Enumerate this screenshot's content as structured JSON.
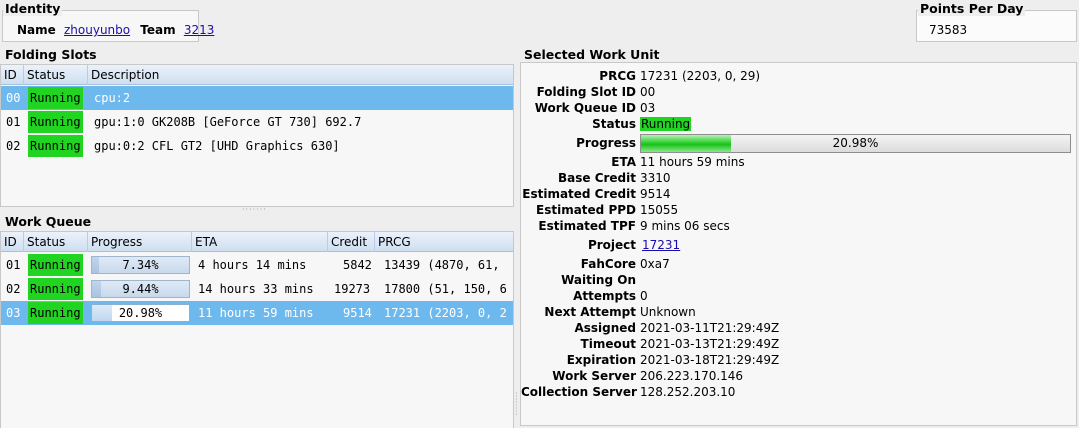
{
  "identity": {
    "title": "Identity",
    "name_label": "Name",
    "name_value": "zhouyunbo",
    "team_label": "Team",
    "team_value": "3213"
  },
  "ppd": {
    "title": "Points Per Day",
    "value": "73583"
  },
  "slots": {
    "title": "Folding Slots",
    "headers": [
      "ID",
      "Status",
      "Description"
    ],
    "rows": [
      {
        "id": "00",
        "status": "Running",
        "description": "cpu:2",
        "selected": true
      },
      {
        "id": "01",
        "status": "Running",
        "description": "gpu:1:0 GK208B [GeForce GT 730] 692.7",
        "selected": false
      },
      {
        "id": "02",
        "status": "Running",
        "description": "gpu:0:2 CFL GT2 [UHD Graphics 630]",
        "selected": false
      }
    ]
  },
  "queue": {
    "title": "Work Queue",
    "headers": [
      "ID",
      "Status",
      "Progress",
      "ETA",
      "Credit",
      "PRCG"
    ],
    "rows": [
      {
        "id": "01",
        "status": "Running",
        "progress_text": "7.34%",
        "progress": 0.0734,
        "eta": "4 hours 14 mins",
        "credit": "5842",
        "prcg": "13439 (4870, 61,",
        "selected": false
      },
      {
        "id": "02",
        "status": "Running",
        "progress_text": "9.44%",
        "progress": 0.0944,
        "eta": "14 hours 33 mins",
        "credit": "19273",
        "prcg": "17800 (51, 150, 6",
        "selected": false
      },
      {
        "id": "03",
        "status": "Running",
        "progress_text": "20.98%",
        "progress": 0.2098,
        "eta": "11 hours 59 mins",
        "credit": "9514",
        "prcg": "17231 (2203, 0, 2",
        "selected": true
      }
    ]
  },
  "unit": {
    "title": "Selected Work Unit",
    "prcg_label": "PRCG",
    "prcg": "17231 (2203, 0, 29)",
    "slot_label": "Folding Slot ID",
    "slot": "00",
    "wq_label": "Work Queue ID",
    "wq": "03",
    "status_label": "Status",
    "status": "Running",
    "progress_label": "Progress",
    "progress_text": "20.98%",
    "progress": 0.2098,
    "eta_label": "ETA",
    "eta": "11 hours 59 mins",
    "base_credit_label": "Base Credit",
    "base_credit": "3310",
    "est_credit_label": "Estimated Credit",
    "est_credit": "9514",
    "est_ppd_label": "Estimated PPD",
    "est_ppd": "15055",
    "est_tpf_label": "Estimated TPF",
    "est_tpf": "9 mins 06 secs",
    "project_label": "Project",
    "project": "17231",
    "fahcore_label": "FahCore",
    "fahcore": "0xa7",
    "waiting_label": "Waiting On",
    "waiting": "",
    "attempts_label": "Attempts",
    "attempts": "0",
    "next_attempt_label": "Next Attempt",
    "next_attempt": "Unknown",
    "assigned_label": "Assigned",
    "assigned": "2021-03-11T21:29:49Z",
    "timeout_label": "Timeout",
    "timeout": "2021-03-13T21:29:49Z",
    "expiration_label": "Expiration",
    "expiration": "2021-03-18T21:29:49Z",
    "ws_label": "Work Server",
    "ws": "206.223.170.146",
    "cs_label": "Collection Server",
    "cs": "128.252.203.10"
  },
  "colors": {
    "running": "#21d421",
    "selected_row": "#6db9ee",
    "link": "#1a0dab"
  }
}
